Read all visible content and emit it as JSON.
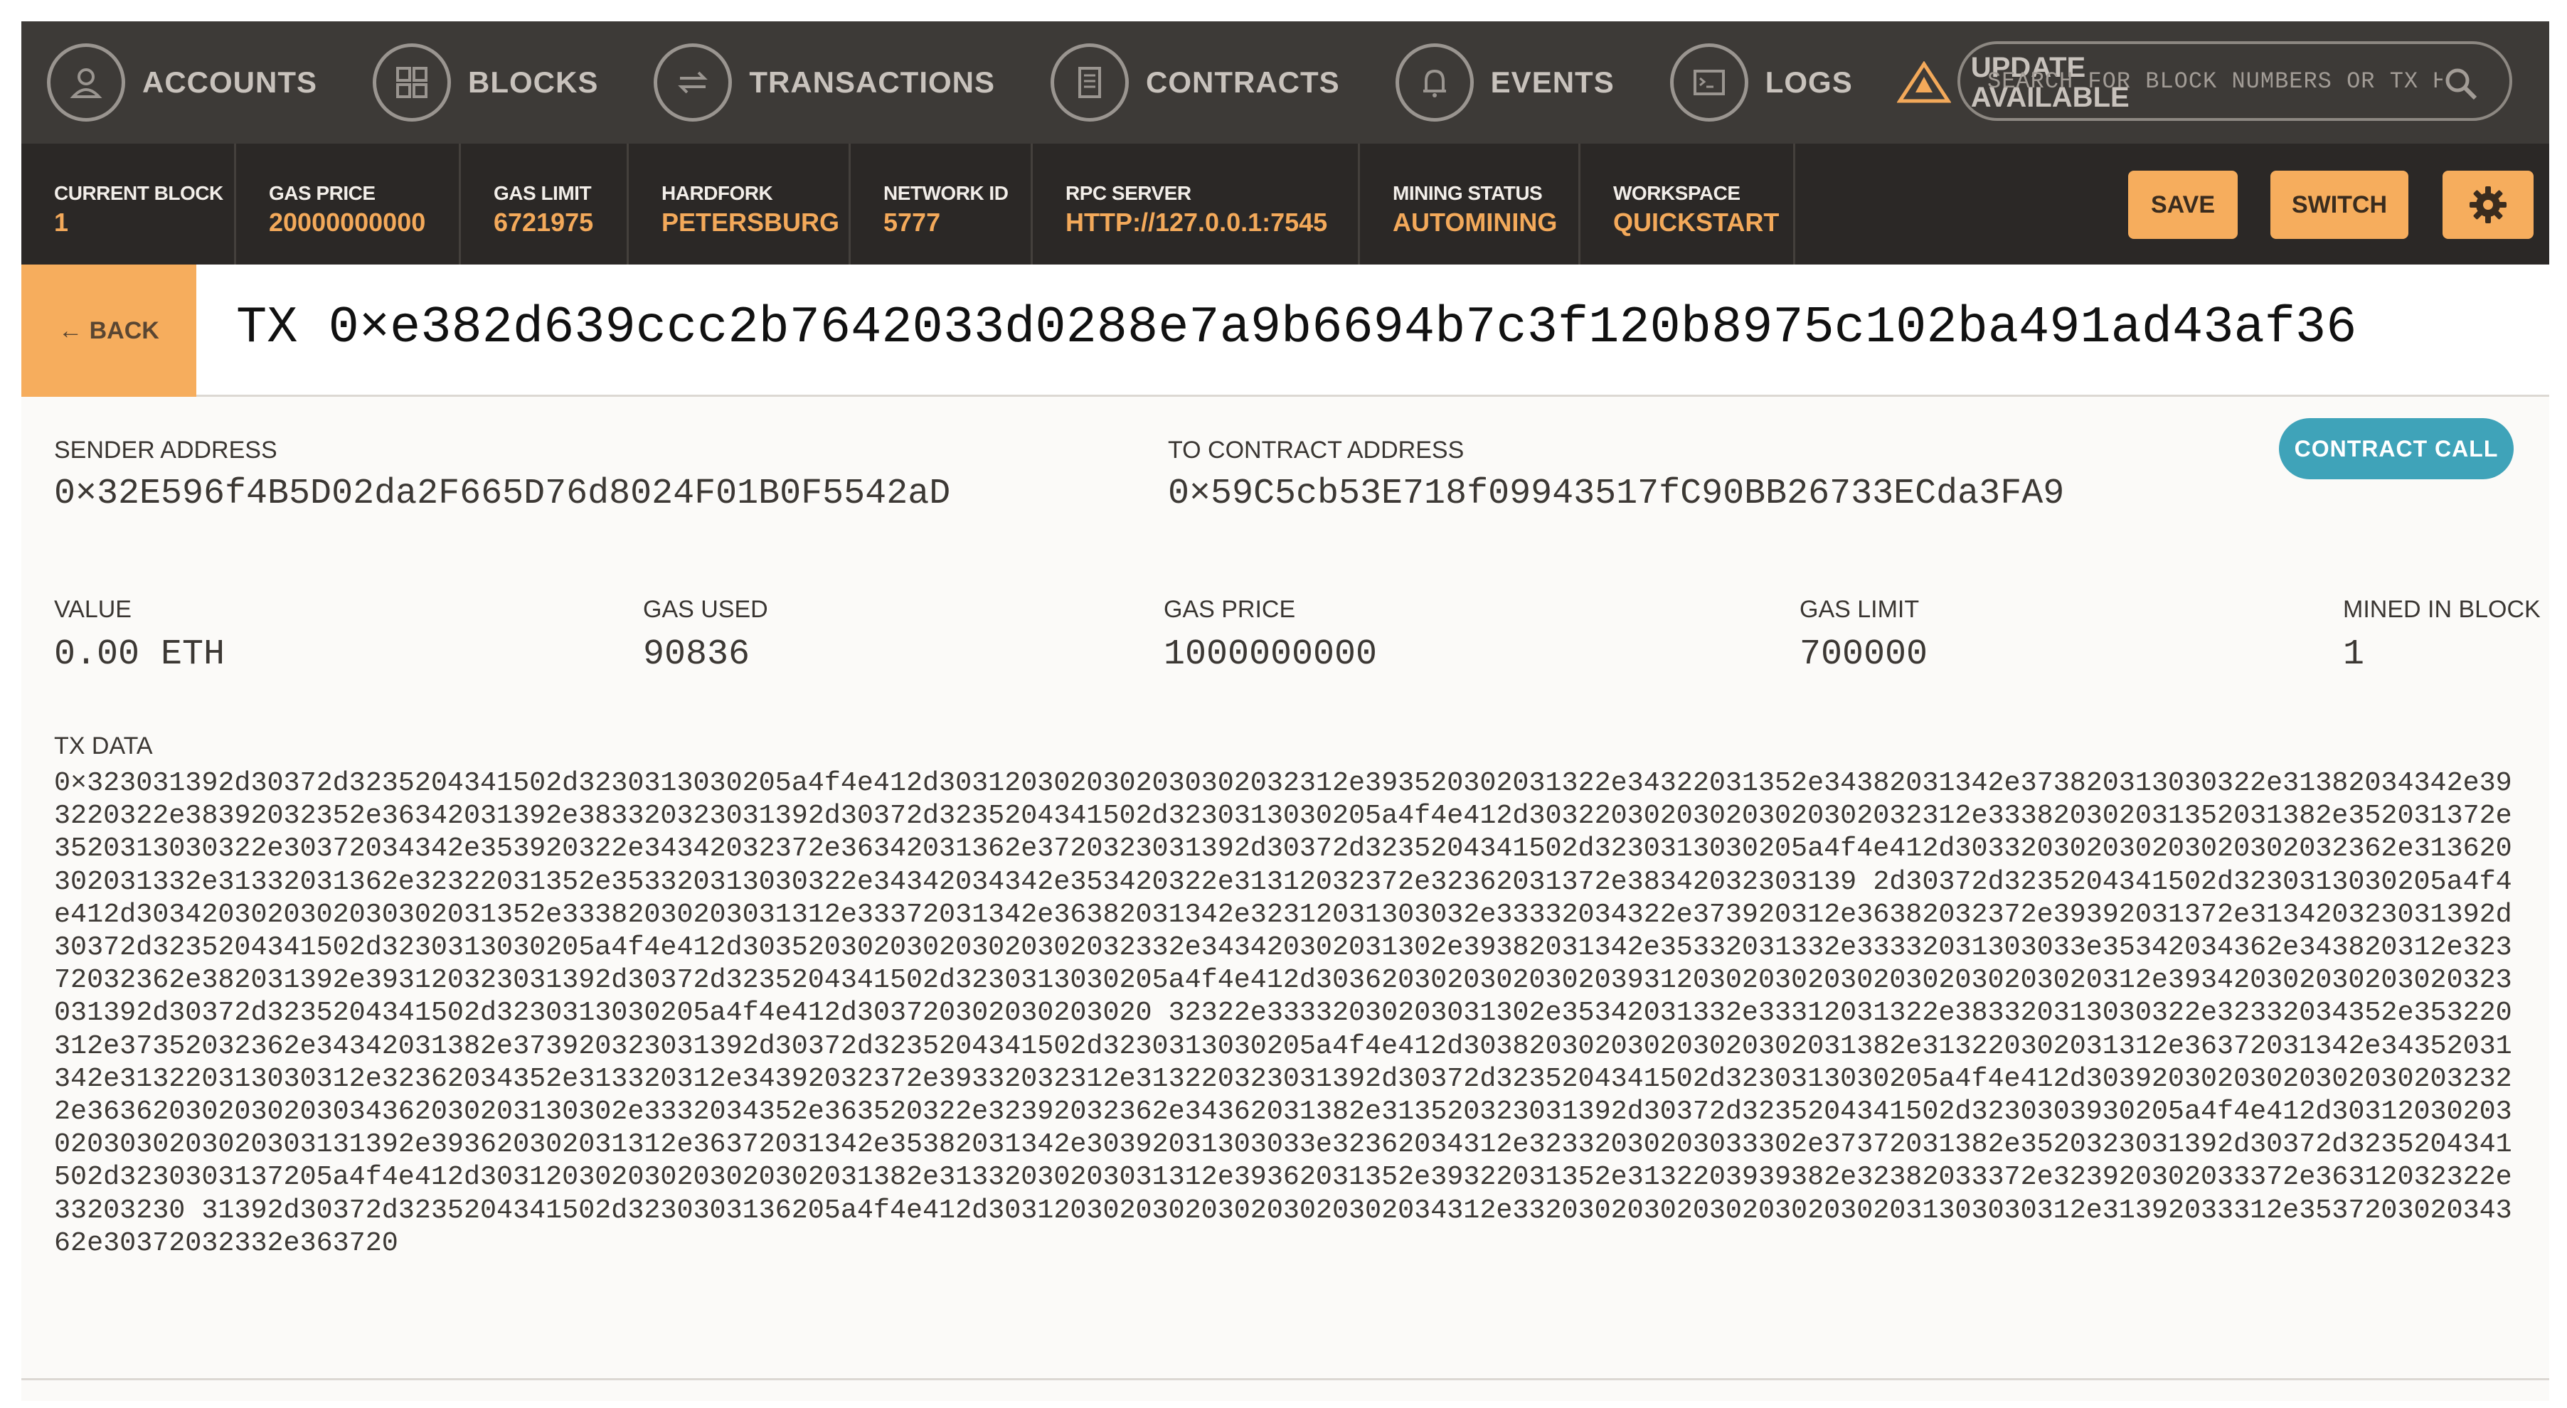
{
  "nav": {
    "accounts": "ACCOUNTS",
    "blocks": "BLOCKS",
    "transactions": "TRANSACTIONS",
    "contracts": "CONTRACTS",
    "events": "EVENTS",
    "logs": "LOGS",
    "update": "UPDATE\nAVAILABLE",
    "search_placeholder": "SEARCH FOR BLOCK NUMBERS OR TX HASHES"
  },
  "status": {
    "current_block": {
      "label": "CURRENT BLOCK",
      "value": "1"
    },
    "gas_price": {
      "label": "GAS PRICE",
      "value": "20000000000"
    },
    "gas_limit": {
      "label": "GAS LIMIT",
      "value": "6721975"
    },
    "hardfork": {
      "label": "HARDFORK",
      "value": "PETERSBURG"
    },
    "network_id": {
      "label": "NETWORK ID",
      "value": "5777"
    },
    "rpc_server": {
      "label": "RPC SERVER",
      "value": "HTTP://127.0.0.1:7545"
    },
    "mining_status": {
      "label": "MINING STATUS",
      "value": "AUTOMINING"
    },
    "workspace": {
      "label": "WORKSPACE",
      "value": "QUICKSTART"
    },
    "save": "SAVE",
    "switch": "SWITCH"
  },
  "tx": {
    "back": "← BACK",
    "title": "TX 0×e382d639ccc2b7642033d0288e7a9b6694b7c3f120b8975c102ba491ad43af36",
    "sender_label": "SENDER ADDRESS",
    "sender": "0×32E596f4B5D02da2F665D76d8024F01B0F5542aD",
    "to_label": "TO CONTRACT ADDRESS",
    "to": "0×59C5cb53E718f09943517fC90BB26733ECda3FA9",
    "type_badge": "CONTRACT CALL",
    "value_label": "VALUE",
    "value": "0.00 ETH",
    "gas_used_label": "GAS USED",
    "gas_used": "90836",
    "gas_price_label": "GAS PRICE",
    "gas_price": "1000000000",
    "gas_limit_label": "GAS LIMIT",
    "gas_limit": "700000",
    "mined_label": "MINED IN BLOCK",
    "mined": "1",
    "data_label": "TX DATA",
    "data": "0×323031392d30372d3235204341502d3230313030205a4f4e412d3031203020302030302032312e393520302031322e34322031352e34382031342e373820313030322e31382034342e393220322e38392032352e36342031392e383320323031392d30372d3235204341502d3230313030205a4f4e412d303220302030203020302032312e333820302031352031382e352031372e3520313030322e30372034342e353920322e34342032372e36342031362e3720323031392d30372d3235204341502d3230313030205a4f4e412d303320302030203020302032362e313620302031332e31332031362e32322031352e353320313030322e34342034342e353420322e31312032372e32362031372e38342032303139 2d30372d3235204341502d3230313030205a4f4e412d3034203020302030302031352e33382030203031312e33372031342e36382031342e32312031303032e33332034322e373920312e36382032372e39392031372e313420323031392d30372d3235204341502d3230313030205a4f4e412d303520302030203020302032332e343420302031302e39382031342e35332031332e33332031303033e35342034362e343820312e32372032362e382031392e393120323031392d30372d3235204341502d3230313030205a4f4e412d303620302030203020393120302030203020302030203020312e393420302030203020323031392d30372d3235204341502d3230313030205a4f4e412d303720302030203020 32322e33332030203031302e35342031332e33312031322e383320313030322e32332034352e353220312e37352032362e34342031382e373920323031392d30372d3235204341502d3230313030205a4f4e412d303820302030203020302031382e313220302031312e36372031342e34352031342e313220313030312e32362034352e313320312e34392032372e39332032312e313220323031392d30372d3235204341502d3230313030205a4f4e412d303920302030203020302032322e363620302030203034362030203130302e3332034352e363520322e32392032362e34362031382e313520323031392d30372d3235204341502d3230303930205a4f4e412d303120302030203030203020303131392e393620302031312e36372031342e35382031342e30392031303033e32362034312e32332030203033302e37372031382e3520323031392d30372d3235204341502d3230303137205a4f4e412d303120302030203020302031382e31332030203031312e39362031352e39322031352e3132203939382e32382033372e323920302033372e36312032322e33203230 31392d30372d3235204341502d3230303136205a4f4e412d3031203020302030203020302034312e33203020302030203020302031303030312e31392033312e353720302034362e30372032332e363720"
  }
}
